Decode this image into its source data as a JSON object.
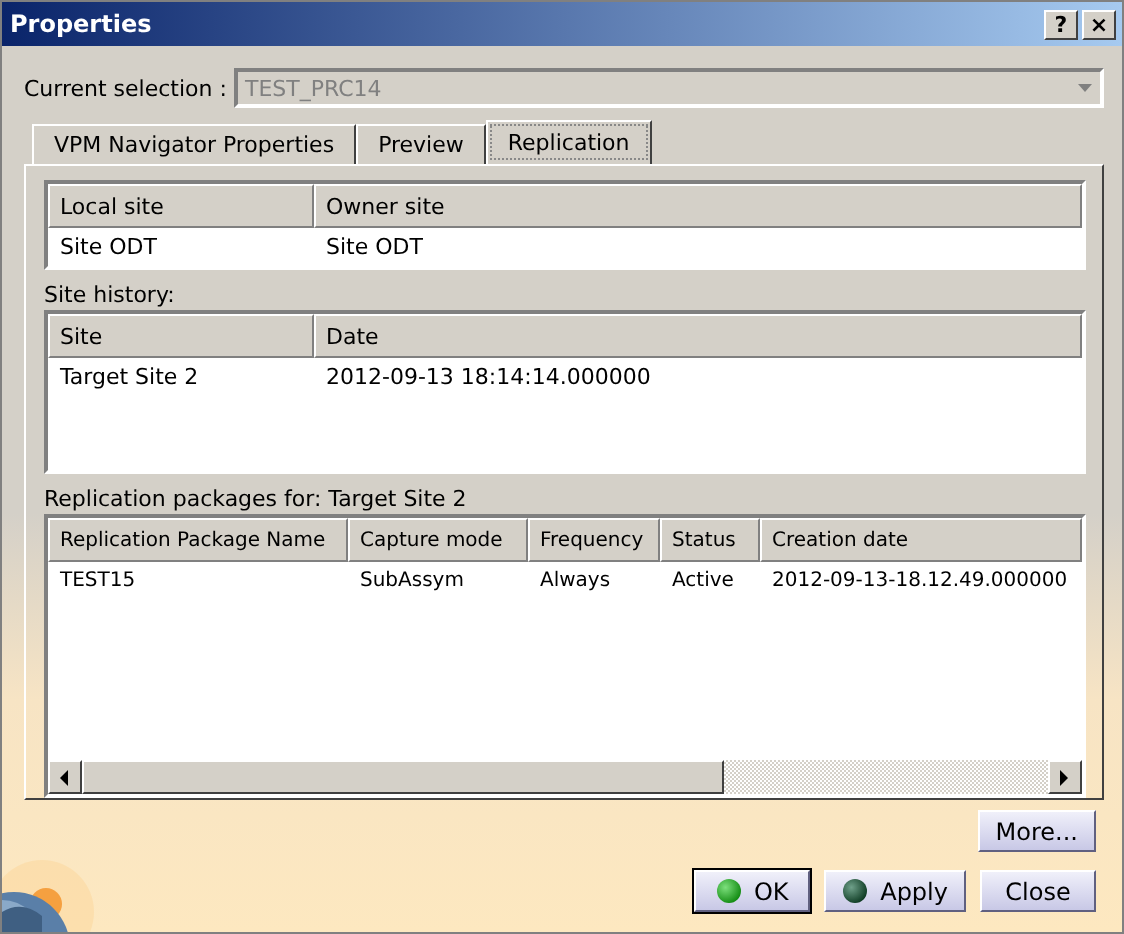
{
  "window": {
    "title": "Properties",
    "help_button": "?",
    "close_button": "×"
  },
  "selection": {
    "label": "Current selection :",
    "value": "TEST_PRC14",
    "disabled": true
  },
  "tabs": [
    {
      "label": "VPM Navigator Properties",
      "selected": false
    },
    {
      "label": "Preview",
      "selected": false
    },
    {
      "label": "Replication",
      "selected": true
    }
  ],
  "sites_table": {
    "columns": [
      "Local site",
      "Owner site"
    ],
    "rows": [
      [
        "Site ODT",
        "Site ODT"
      ]
    ]
  },
  "site_history": {
    "label": "Site history:",
    "columns": [
      "Site",
      "Date"
    ],
    "rows": [
      [
        "Target Site 2",
        "2012-09-13 18:14:14.000000"
      ]
    ]
  },
  "packages": {
    "label": "Replication packages for: Target Site 2",
    "columns": [
      "Replication Package Name",
      "Capture mode",
      "Frequency",
      "Status",
      "Creation date"
    ],
    "rows": [
      [
        "TEST15",
        "SubAssym",
        "Always",
        "Active",
        "2012-09-13-18.12.49.000000"
      ]
    ]
  },
  "more_button": "More...",
  "buttons": [
    {
      "label": "OK",
      "kind": "ok",
      "default": true
    },
    {
      "label": "Apply",
      "kind": "apply",
      "default": false
    },
    {
      "label": "Close",
      "kind": "plain",
      "default": false
    }
  ]
}
